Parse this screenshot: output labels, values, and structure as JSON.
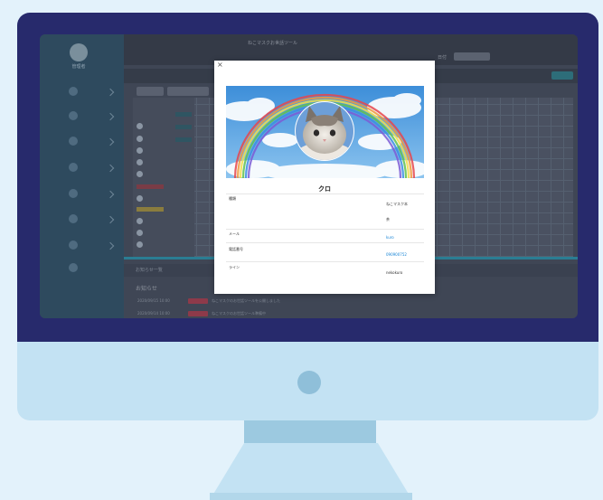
{
  "background_color": "#e3f2fb",
  "monitor": {
    "bezel_color": "#272a6c",
    "chin_color": "#c3e2f3"
  },
  "app": {
    "title": "ねこマスクお世話ツール",
    "sidebar_user": "管理者",
    "header_filter_label": "日付"
  },
  "modal": {
    "close_label": "×",
    "profile_name": "クロ",
    "cover_image": "cat-on-rainbow-sky",
    "fields": [
      {
        "label": "種類",
        "value": "ねこマスク本",
        "is_link": false
      },
      {
        "label": "",
        "value": "茶",
        "is_link": false
      },
      {
        "label": "メール",
        "value": "kuro",
        "is_link": true
      },
      {
        "label": "電話番号",
        "value": "090900752",
        "is_link": true
      },
      {
        "label": "ライン",
        "value": "nekokuro",
        "is_link": false
      }
    ]
  },
  "lower_section": {
    "bar_label": "お知らせ一覧",
    "title": "お知らせ",
    "items": [
      {
        "date": "2020/09/15 10:00",
        "text": "ねこマスクのお世話ツールを公開しました"
      },
      {
        "date": "2020/09/14 10:00",
        "text": "ねこマスクのお世話ツール準備中"
      }
    ]
  }
}
